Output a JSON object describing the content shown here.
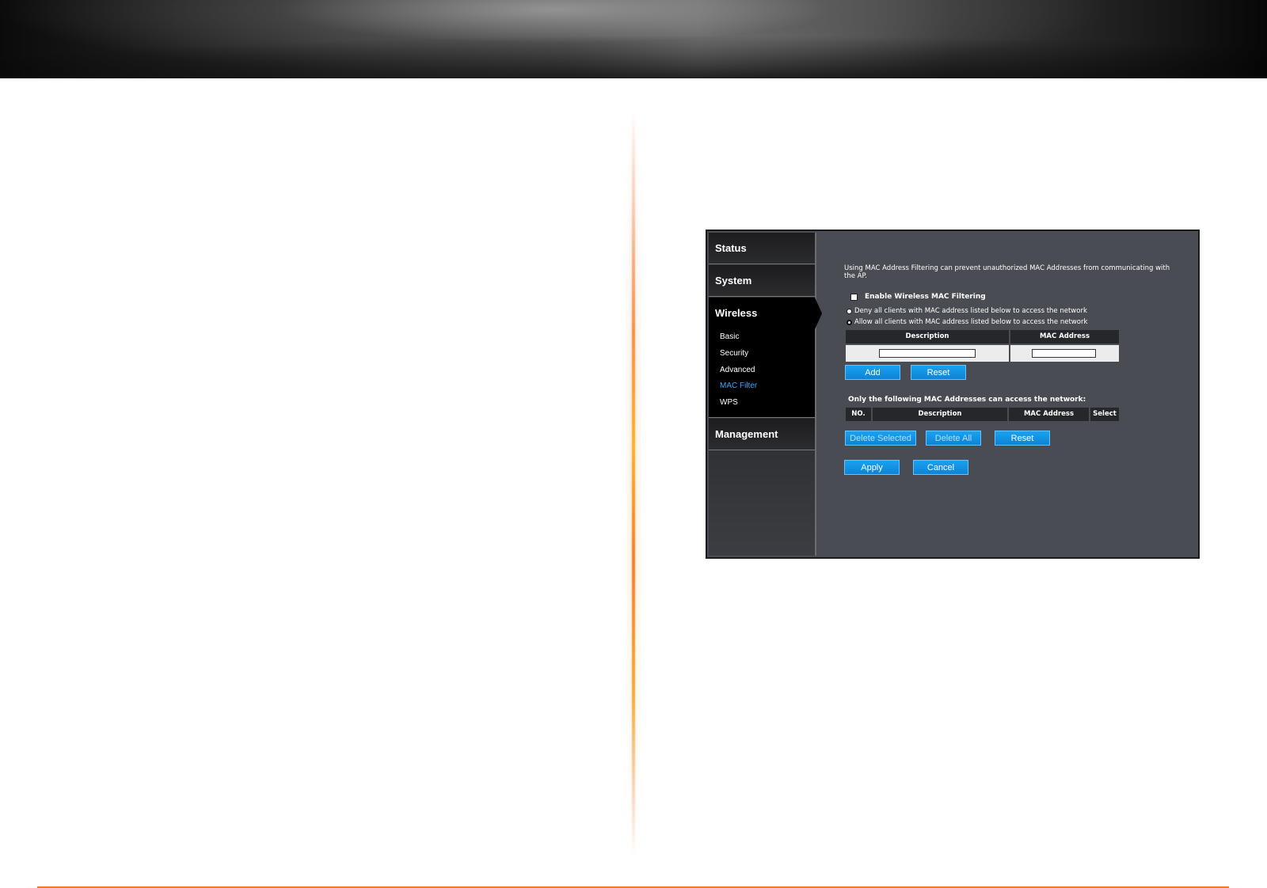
{
  "nav": {
    "status": "Status",
    "system": "System",
    "wireless": "Wireless",
    "wireless_sub": [
      "Basic",
      "Security",
      "Advanced",
      "MAC Filter",
      "WPS"
    ],
    "management": "Management"
  },
  "mac_filter": {
    "description": "Using MAC Address Filtering can prevent unauthorized MAC Addresses from communicating with the AP.",
    "enable_label": "Enable Wireless MAC Filtering",
    "deny_label": "Deny all clients with MAC address listed below to access the network",
    "allow_label": "Allow all clients with MAC address listed below to access the network",
    "selected_mode": "allow",
    "input_table": {
      "col_description": "Description",
      "col_mac": "MAC Address",
      "description_value": "",
      "mac_value": ""
    },
    "add_button": "Add",
    "reset_button": "Reset",
    "list_title": "Only the following MAC Addresses can access the network:",
    "list_table": {
      "col_no": "NO.",
      "col_description": "Description",
      "col_mac": "MAC Address",
      "col_select": "Select"
    },
    "delete_selected_button": "Delete Selected",
    "delete_all_button": "Delete All",
    "list_reset_button": "Reset",
    "apply_button": "Apply",
    "cancel_button": "Cancel"
  },
  "colors": {
    "accent_orange": "#f07a2a",
    "button_blue": "#0d83d6",
    "active_link": "#3aa8ff",
    "panel_bg": "#4a4c53"
  }
}
